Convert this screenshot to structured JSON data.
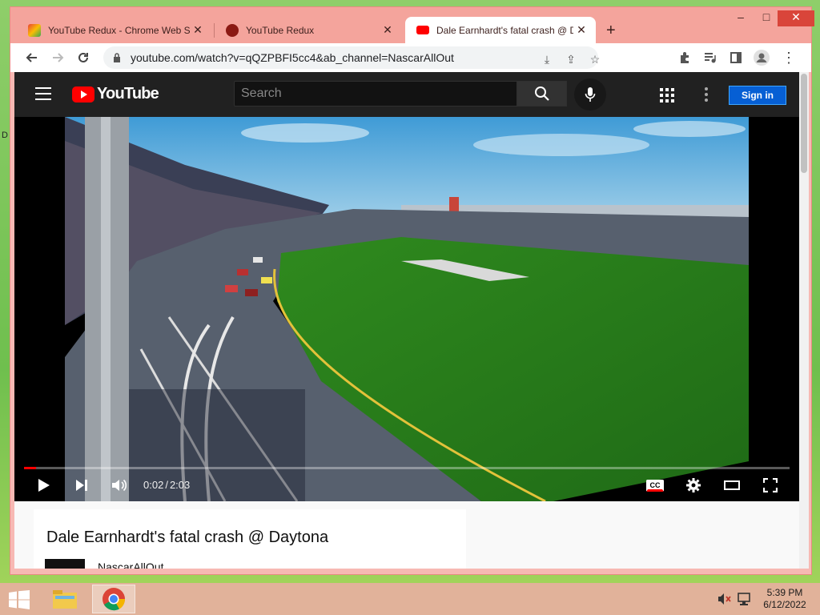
{
  "browser": {
    "tabs": [
      {
        "label": "YouTube Redux - Chrome Web Sto",
        "favicon": "chrome-web-store-icon"
      },
      {
        "label": "YouTube Redux",
        "favicon": "youtube-redux-icon"
      },
      {
        "label": "Dale Earnhardt's fatal crash @ Da",
        "favicon": "youtube-icon"
      }
    ],
    "new_tab_glyph": "+",
    "url": "youtube.com/watch?v=qQZPBFI5cc4&ab_channel=NascarAllOut",
    "window_controls": {
      "minimize": "–",
      "maximize": "□",
      "close": "✕"
    }
  },
  "youtube": {
    "logo_text": "YouTube",
    "search_placeholder": "Search",
    "sign_in_label": "Sign in",
    "player": {
      "current_time": "0:02",
      "duration": "2:03",
      "progress_fraction": 0.016,
      "cc_label": "CC"
    },
    "video_title": "Dale Earnhardt's fatal crash @ Daytona",
    "channel_name": "NascarAllOut"
  },
  "taskbar": {
    "time": "5:39 PM",
    "date": "6/12/2022",
    "apps": [
      "file-explorer-icon",
      "chrome-icon"
    ]
  },
  "colors": {
    "titlebar": "#f4a49c",
    "youtube_red": "#ff0000",
    "sign_in_blue": "#065fd4",
    "header_dark": "#212121"
  }
}
